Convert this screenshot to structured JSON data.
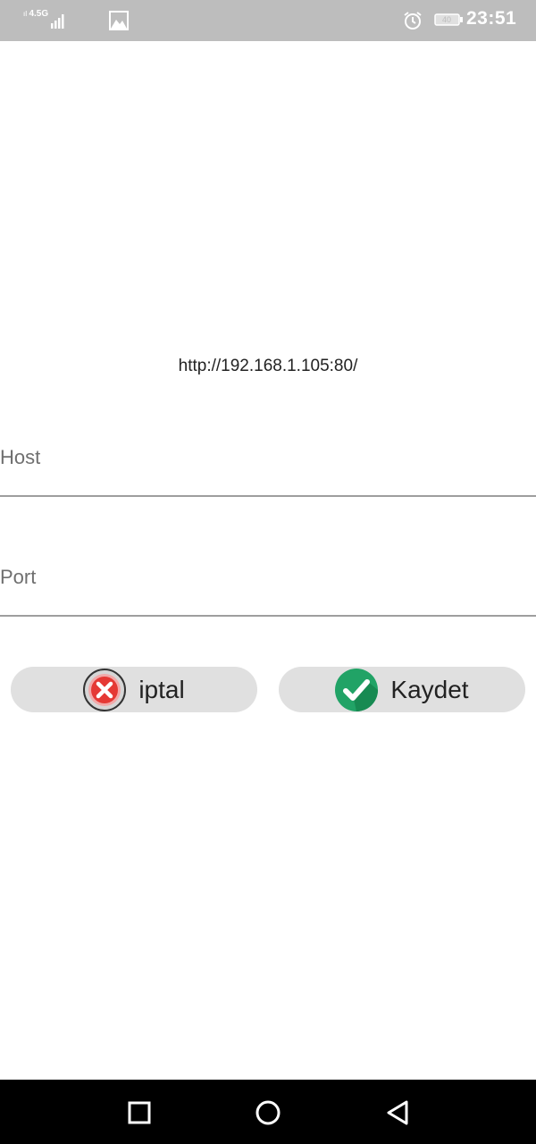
{
  "status_bar": {
    "network_type": "4.5G",
    "time": "23:51",
    "battery_level": "40",
    "icons": [
      "signal-icon",
      "gallery-icon",
      "alarm-icon",
      "battery-icon"
    ]
  },
  "server": {
    "url": "http://192.168.1.105:80/"
  },
  "form": {
    "host_placeholder": "Host",
    "host_value": "",
    "port_placeholder": "Port",
    "port_value": ""
  },
  "actions": {
    "cancel_label": "iptal",
    "save_label": "Kaydet",
    "cancel_icon": "cancel-x-icon",
    "save_icon": "check-icon"
  },
  "navigation": {
    "buttons": [
      "recents-icon",
      "home-icon",
      "back-icon"
    ]
  },
  "colors": {
    "status_bar": "#bdbdbd",
    "button_bg": "#e0e0e0",
    "cancel_red": "#e53935",
    "save_green": "#21a366",
    "nav_bar": "#000000"
  }
}
